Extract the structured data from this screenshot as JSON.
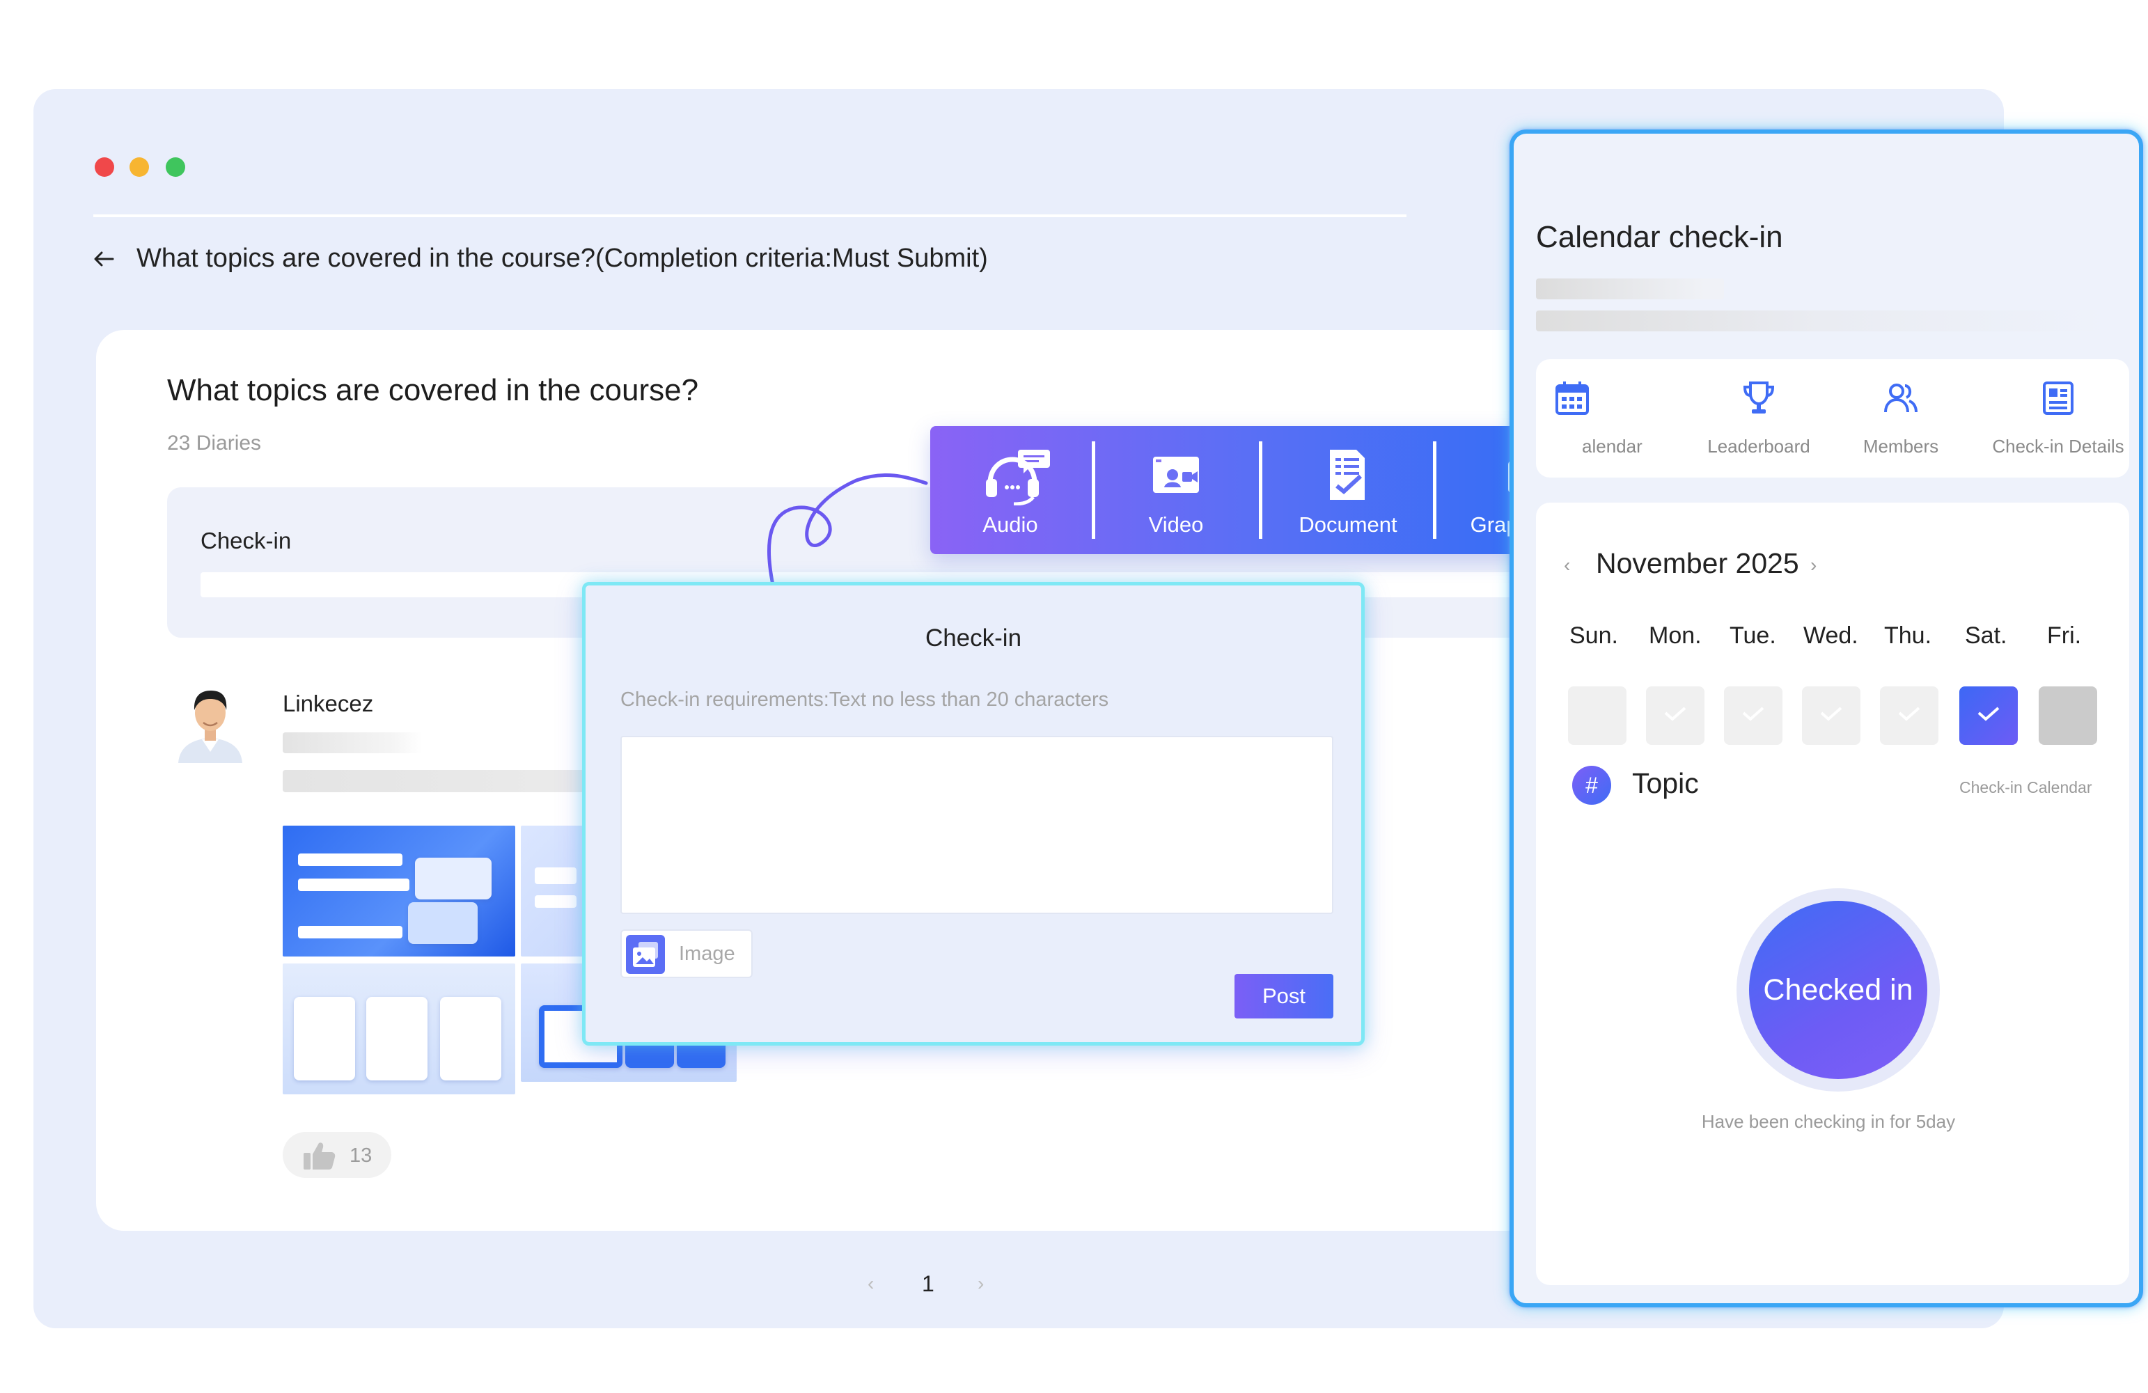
{
  "window": {
    "heading": "What topics are covered in the course?(Completion criteria:Must Submit)"
  },
  "content": {
    "question_title": "What topics are covered in the course?",
    "diaries_count": "23 Diaries",
    "checkin_box_label": "Check-in",
    "user_name": "Linkecez",
    "like_count": "13",
    "pagination": {
      "prev": "‹",
      "current": "1",
      "next": "›"
    }
  },
  "toolbar": {
    "items": [
      {
        "label": "Audio",
        "icon": "headset-icon"
      },
      {
        "label": "Video",
        "icon": "video-icon"
      },
      {
        "label": "Document",
        "icon": "document-icon"
      },
      {
        "label": "Graphic-text",
        "icon": "graphic-text-icon"
      }
    ]
  },
  "dialog": {
    "title": "Check-in",
    "requirement": "Check-in requirements:Text no less than 20 characters",
    "textarea_value": "",
    "image_label": "Image",
    "post_label": "Post"
  },
  "calendar": {
    "title": "Calendar check-in",
    "tabs": [
      {
        "label": "Calendar",
        "icon": "calendar-icon"
      },
      {
        "label": "Leaderboard",
        "icon": "trophy-icon"
      },
      {
        "label": "Members",
        "icon": "members-icon"
      },
      {
        "label": "Check-in Details",
        "icon": "details-icon"
      }
    ],
    "month": "November 2025",
    "weekdays": [
      "Sun.",
      "Mon.",
      "Tue.",
      "Wed.",
      "Thu.",
      "Sat.",
      "Fri."
    ],
    "days": [
      {
        "state": "empty"
      },
      {
        "state": "checked"
      },
      {
        "state": "checked"
      },
      {
        "state": "checked"
      },
      {
        "state": "checked"
      },
      {
        "state": "today"
      },
      {
        "state": "future"
      }
    ],
    "topic_label": "Topic",
    "topic_icon": "#",
    "calendar_link": "Check-in Calendar",
    "checked_button": "Checked in",
    "streak_text": "Have been checking in for 5day"
  },
  "colors": {
    "accent_blue": "#3f6cf5",
    "accent_purple": "#7e5ff6",
    "glow_cyan": "#7ee8f5",
    "window_bg": "#e9eefb"
  }
}
